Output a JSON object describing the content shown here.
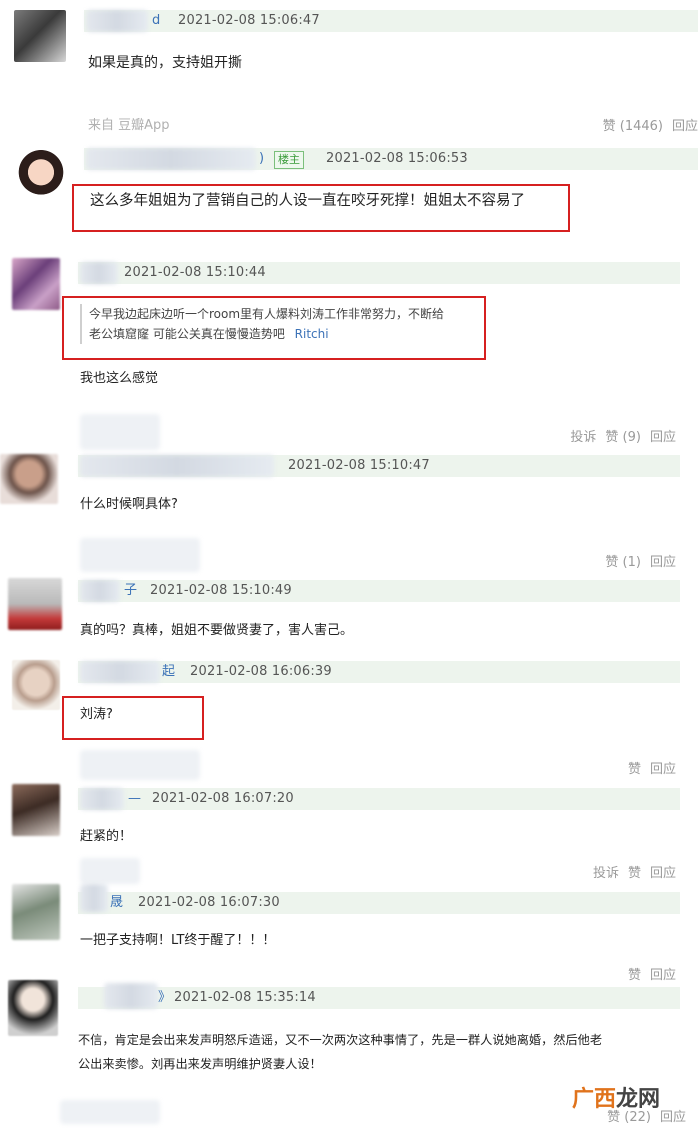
{
  "comments": [
    {
      "username": "d",
      "time": "2021-02-08 15:06:47",
      "text": "如果是真的，支持姐开撕",
      "source": "来自 豆瓣App",
      "like": "赞 (1446)",
      "reply": "回应"
    },
    {
      "username": ")",
      "op_badge": "楼主",
      "time": "2021-02-08 15:06:53",
      "text": "这么多年姐姐为了营销自己的人设一直在咬牙死撑！姐姐太不容易了"
    },
    {
      "username": "",
      "time": "2021-02-08 15:10:44",
      "quote_line1": "今早我边起床边听一个room里有人爆料刘涛工作非常努力，不断给",
      "quote_line2": "老公填窟窿 可能公关真在慢慢造势吧",
      "quote_user": "Ritchi",
      "text": "我也这么感觉",
      "report": "投诉",
      "like": "赞 (9)",
      "reply": "回应"
    },
    {
      "username": "",
      "time": "2021-02-08 15:10:47",
      "text": "什么时候啊具体?",
      "like": "赞 (1)",
      "reply": "回应"
    },
    {
      "username": "子",
      "time": "2021-02-08 15:10:49",
      "text": "真的吗？真棒，姐姐不要做贤妻了，害人害己。"
    },
    {
      "username": "起",
      "time": "2021-02-08 16:06:39",
      "text": "刘涛?",
      "like": "赞",
      "reply": "回应"
    },
    {
      "username": "—",
      "time": "2021-02-08 16:07:20",
      "text": "赶紧的！",
      "report": "投诉",
      "like": "赞",
      "reply": "回应"
    },
    {
      "username": "晟",
      "time": "2021-02-08 16:07:30",
      "text": "一把子支持啊！LT终于醒了！！！",
      "like": "赞",
      "reply": "回应"
    },
    {
      "username": "》",
      "time": "2021-02-08 15:35:14",
      "text_line1": "不信，肯定是会出来发声明怒斥造谣，又不一次两次这种事情了，先是一群人说她离婚，然后他老",
      "text_line2": "公出来卖惨。刘再出来发声明维护贤妻人设！",
      "like": "赞 (22)",
      "reply": "回应"
    }
  ],
  "watermark": {
    "part1": "广西",
    "part2": "龙网"
  },
  "colors": {
    "accent_link": "#3c72b7",
    "highlight_box": "#d62020",
    "meta_bar": "#edf4ed"
  }
}
